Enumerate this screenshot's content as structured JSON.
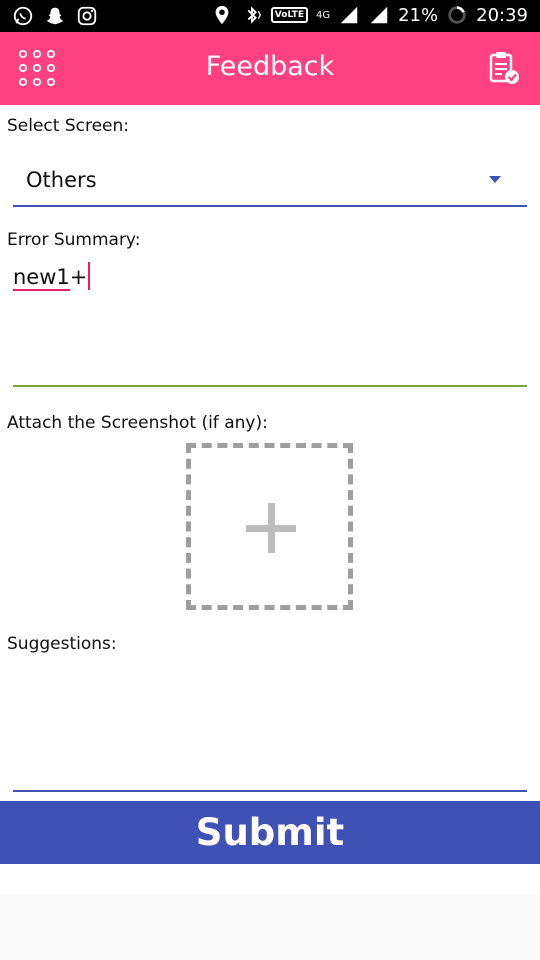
{
  "status_bar": {
    "icons_left": [
      "whatsapp-icon",
      "snapchat-icon",
      "instagram-icon"
    ],
    "icons_right": [
      "location-icon",
      "bluetooth-vibrate-icon",
      "volte-badge",
      "signal-icon",
      "signal-icon"
    ],
    "volte": "VoLTE",
    "network": "4G",
    "battery": "21%",
    "time": "20:39"
  },
  "app_bar": {
    "title": "Feedback",
    "menu_icon": "grid-menu-icon",
    "action_icon": "clipboard-check-icon",
    "color": "#ff4081"
  },
  "form": {
    "select_screen_label": "Select Screen:",
    "select_screen_value": "Others",
    "error_summary_label": "Error Summary:",
    "error_summary_value_misspelled": "new1",
    "error_summary_value_rest": "+",
    "attach_label": "Attach the Screenshot (if any):",
    "attach_icon": "plus-icon",
    "suggestions_label": "Suggestions:",
    "suggestions_value": "",
    "submit_label": "Submit"
  },
  "colors": {
    "accent": "#3f51b5",
    "pink": "#ff4081",
    "error_underline": "#7aa33a"
  }
}
